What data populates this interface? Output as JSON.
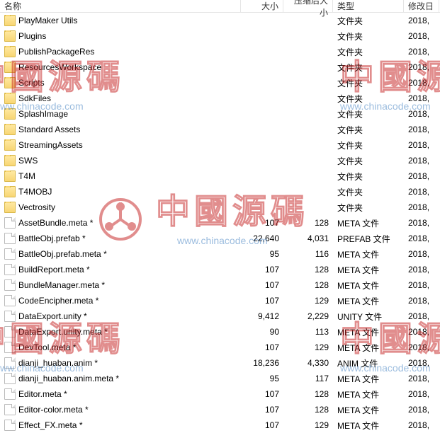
{
  "header": {
    "name": "名称",
    "size": "大小",
    "csize": "压缩后大小",
    "type": "类型",
    "date": "修改日"
  },
  "types": {
    "folder": "文件夹",
    "meta": "META 文件",
    "prefab": "PREFAB 文件",
    "unity": "UNITY 文件",
    "anim": "ANIM 文件"
  },
  "common": {
    "year": "2018,"
  },
  "rows": [
    {
      "icon": "folder",
      "name": "PlayMaker Utils",
      "size": "",
      "csize": "",
      "typeKey": "folder"
    },
    {
      "icon": "folder",
      "name": "Plugins",
      "size": "",
      "csize": "",
      "typeKey": "folder"
    },
    {
      "icon": "folder",
      "name": "PublishPackageRes",
      "size": "",
      "csize": "",
      "typeKey": "folder"
    },
    {
      "icon": "folder",
      "name": "ResourcesWorkspace",
      "size": "",
      "csize": "",
      "typeKey": "folder"
    },
    {
      "icon": "folder",
      "name": "Scripts",
      "size": "",
      "csize": "",
      "typeKey": "folder"
    },
    {
      "icon": "folder",
      "name": "SdkFiles",
      "size": "",
      "csize": "",
      "typeKey": "folder"
    },
    {
      "icon": "folder",
      "name": "SplashImage",
      "size": "",
      "csize": "",
      "typeKey": "folder"
    },
    {
      "icon": "folder",
      "name": "Standard Assets",
      "size": "",
      "csize": "",
      "typeKey": "folder"
    },
    {
      "icon": "folder",
      "name": "StreamingAssets",
      "size": "",
      "csize": "",
      "typeKey": "folder"
    },
    {
      "icon": "folder",
      "name": "SWS",
      "size": "",
      "csize": "",
      "typeKey": "folder"
    },
    {
      "icon": "folder",
      "name": "T4M",
      "size": "",
      "csize": "",
      "typeKey": "folder"
    },
    {
      "icon": "folder",
      "name": "T4MOBJ",
      "size": "",
      "csize": "",
      "typeKey": "folder"
    },
    {
      "icon": "folder",
      "name": "Vectrosity",
      "size": "",
      "csize": "",
      "typeKey": "folder"
    },
    {
      "icon": "file",
      "name": "AssetBundle.meta *",
      "size": "107",
      "csize": "128",
      "typeKey": "meta"
    },
    {
      "icon": "file",
      "name": "BattleObj.prefab *",
      "size": "22,640",
      "csize": "4,031",
      "typeKey": "prefab"
    },
    {
      "icon": "file",
      "name": "BattleObj.prefab.meta *",
      "size": "95",
      "csize": "116",
      "typeKey": "meta"
    },
    {
      "icon": "file",
      "name": "BuildReport.meta *",
      "size": "107",
      "csize": "128",
      "typeKey": "meta"
    },
    {
      "icon": "file",
      "name": "BundleManager.meta *",
      "size": "107",
      "csize": "128",
      "typeKey": "meta"
    },
    {
      "icon": "file",
      "name": "CodeEncipher.meta *",
      "size": "107",
      "csize": "129",
      "typeKey": "meta"
    },
    {
      "icon": "file",
      "name": "DataExport.unity *",
      "size": "9,412",
      "csize": "2,229",
      "typeKey": "unity"
    },
    {
      "icon": "file",
      "name": "DataExport.unity.meta *",
      "size": "90",
      "csize": "113",
      "typeKey": "meta"
    },
    {
      "icon": "file",
      "name": "DevTool.meta *",
      "size": "107",
      "csize": "129",
      "typeKey": "meta"
    },
    {
      "icon": "file",
      "name": "dianji_huaban.anim *",
      "size": "18,236",
      "csize": "4,330",
      "typeKey": "anim"
    },
    {
      "icon": "file",
      "name": "dianji_huaban.anim.meta *",
      "size": "95",
      "csize": "117",
      "typeKey": "meta"
    },
    {
      "icon": "file",
      "name": "Editor.meta *",
      "size": "107",
      "csize": "128",
      "typeKey": "meta"
    },
    {
      "icon": "file",
      "name": "Editor-color.meta *",
      "size": "107",
      "csize": "128",
      "typeKey": "meta"
    },
    {
      "icon": "file",
      "name": "Effect_FX.meta *",
      "size": "107",
      "csize": "129",
      "typeKey": "meta"
    }
  ],
  "watermark": {
    "text": "中國源碼",
    "url": "www.chinacode.com"
  }
}
